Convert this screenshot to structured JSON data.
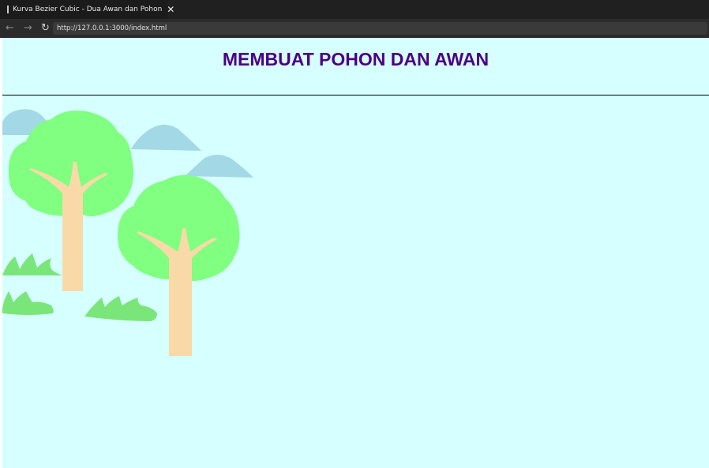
{
  "browser": {
    "tab": {
      "title": "Kurva Bezier Cubic - Dua Awan dan Pohon",
      "close_icon": "✕",
      "icon": "page-icon"
    },
    "nav": {
      "back_icon": "←",
      "forward_icon": "→",
      "reload_icon": "↻"
    },
    "url": "http://127.0.0.1:3000/index.html"
  },
  "page": {
    "title": "MEMBUAT POHON DAN AWAN",
    "background": "#d6ffff",
    "title_color": "#4b0082"
  },
  "scene": {
    "colors": {
      "cloud": "#a3d8e6",
      "foliage": "#80ff80",
      "trunk": "#fad9a8",
      "grass": "#7ae67a"
    }
  }
}
